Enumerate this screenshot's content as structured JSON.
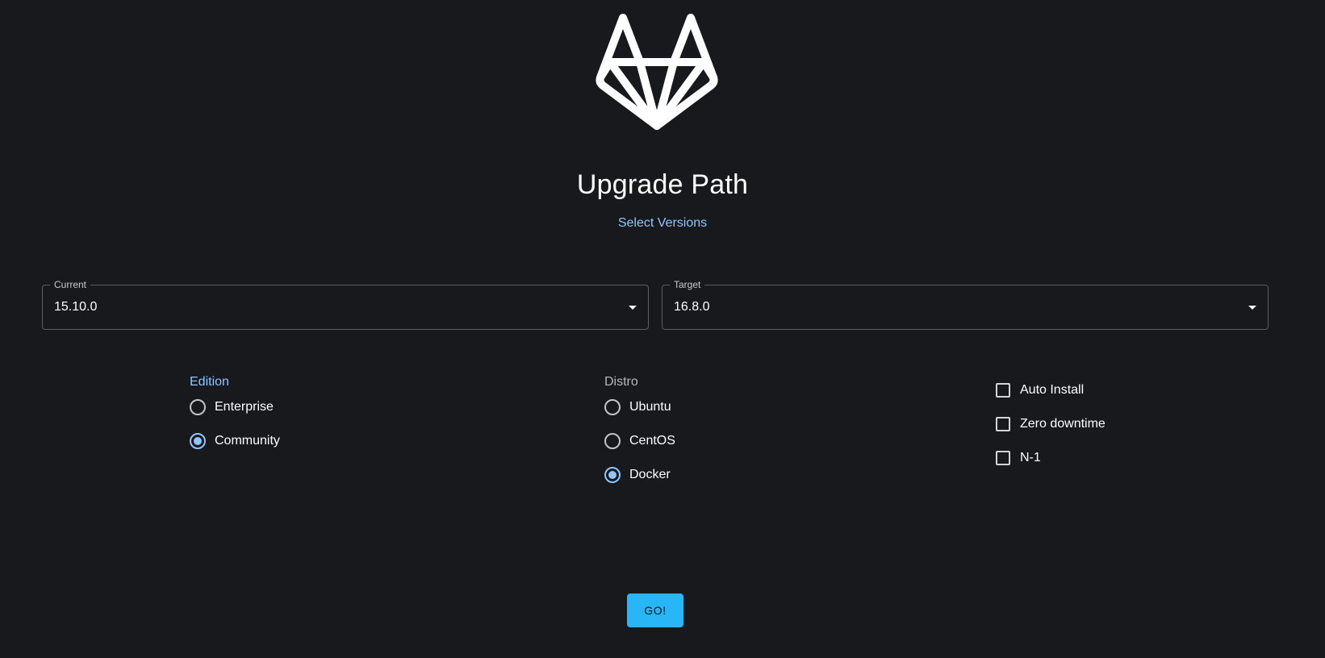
{
  "header": {
    "logo_icon": "gitlab-tanuki-icon",
    "title": "Upgrade Path",
    "subtitle": "Select Versions"
  },
  "versions": {
    "current": {
      "label": "Current",
      "value": "15.10.0"
    },
    "target": {
      "label": "Target",
      "value": "16.8.0"
    }
  },
  "edition": {
    "label": "Edition",
    "options": [
      {
        "label": "Enterprise",
        "selected": false
      },
      {
        "label": "Community",
        "selected": true
      }
    ]
  },
  "distro": {
    "label": "Distro",
    "options": [
      {
        "label": "Ubuntu",
        "selected": false
      },
      {
        "label": "CentOS",
        "selected": false
      },
      {
        "label": "Docker",
        "selected": true
      }
    ]
  },
  "options": [
    {
      "label": "Auto Install",
      "checked": false
    },
    {
      "label": "Zero downtime",
      "checked": false
    },
    {
      "label": "N-1",
      "checked": false
    }
  ],
  "actions": {
    "go_label": "GO!"
  },
  "colors": {
    "background": "#18191d",
    "accent": "#8fc6ff",
    "button": "#29b6f6"
  }
}
